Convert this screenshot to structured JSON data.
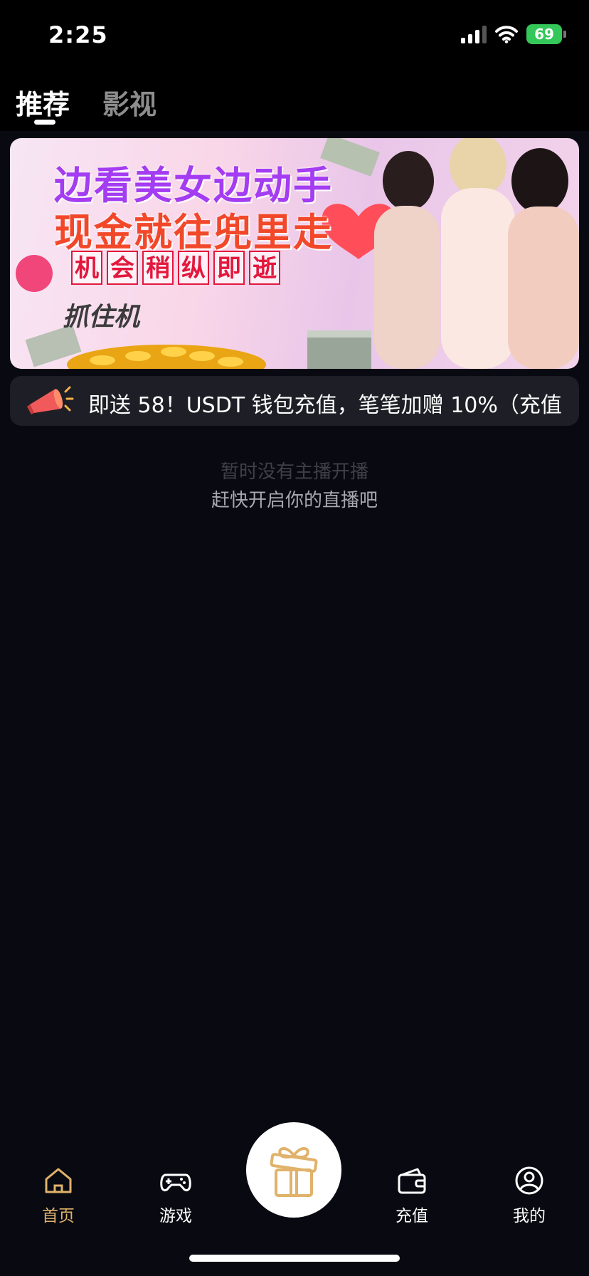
{
  "status_bar": {
    "time": "2:25",
    "battery": "69"
  },
  "tabs": [
    {
      "label": "推荐"
    },
    {
      "label": "影视"
    }
  ],
  "banner": {
    "line1": "边看美女边动手",
    "line2": "现金就往兜里走",
    "tagline": [
      "机",
      "会",
      "稍",
      "纵",
      "即",
      "逝"
    ],
    "logo": "抓住机"
  },
  "notice": {
    "text": "即送 58！USDT 钱包充值，笔笔加赠 10%（充值"
  },
  "empty_state": {
    "title": "暂时没有主播开播",
    "subtitle": "赶快开启你的直播吧"
  },
  "bottom_nav": {
    "home": "首页",
    "games": "游戏",
    "recharge": "充值",
    "mine": "我的"
  },
  "colors": {
    "accent": "#e0b26a",
    "background": "#090912",
    "notice_bg": "#1e1e26"
  }
}
